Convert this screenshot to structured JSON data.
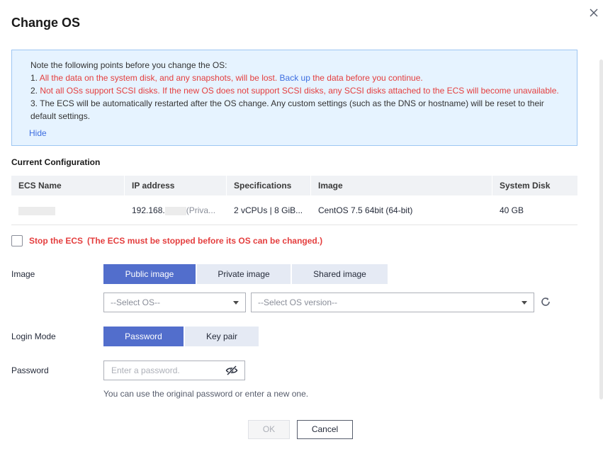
{
  "dialog": {
    "title": "Change OS",
    "close_icon": "close-icon"
  },
  "notice": {
    "intro": "Note the following points before you change the OS:",
    "item1_prefix": "1. ",
    "item1_red_a": "All the data on the system disk, and any snapshots, will be lost.",
    "item1_link": "Back up",
    "item1_red_b": "the data before you continue.",
    "item2_prefix": "2. ",
    "item2_red": "Not all OSs support SCSI disks. If the new OS does not support SCSI disks, any SCSI disks attached to the ECS will become unavailable.",
    "item3": "3. The ECS will be automatically restarted after the OS change. Any custom settings (such as the DNS or hostname) will be reset to their default settings.",
    "hide_label": "Hide"
  },
  "current_config": {
    "title": "Current Configuration",
    "columns": [
      "ECS Name",
      "IP address",
      "Specifications",
      "Image",
      "System Disk"
    ],
    "row": {
      "ecs_name": "",
      "ip_prefix": "192.168.",
      "ip_suffix": "(Priva...",
      "specifications": "2 vCPUs | 8 GiB...",
      "image": "CentOS 7.5 64bit (64-bit)",
      "system_disk": "40 GB"
    }
  },
  "stop_ecs": {
    "label": "Stop the ECS",
    "note": "(The ECS must be stopped before its OS can be changed.)",
    "checked": false
  },
  "image": {
    "label": "Image",
    "tabs": [
      "Public image",
      "Private image",
      "Shared image"
    ],
    "active_tab": "Public image",
    "os_select_placeholder": "--Select OS--",
    "version_select_placeholder": "--Select OS version--",
    "refresh_icon": "refresh-icon"
  },
  "login_mode": {
    "label": "Login Mode",
    "options": [
      "Password",
      "Key pair"
    ],
    "active": "Password"
  },
  "password": {
    "label": "Password",
    "placeholder": "Enter a password.",
    "toggle_icon": "eye-hidden-icon",
    "hint": "You can use the original password or enter a new one."
  },
  "footer": {
    "ok_label": "OK",
    "cancel_label": "Cancel"
  },
  "colors": {
    "accent": "#526ecc",
    "warning_red": "#e43e3e",
    "link_blue": "#3e6ee0",
    "notice_bg": "#e6f3ff"
  }
}
